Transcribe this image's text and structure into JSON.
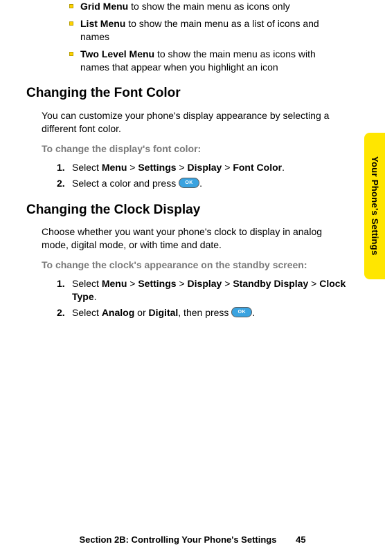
{
  "side_tab": "Your Phone's Settings",
  "bullets": [
    {
      "bold": "Grid Menu",
      "rest": " to show the main menu as icons only"
    },
    {
      "bold": "List Menu",
      "rest": " to show the main menu as a list of icons and names"
    },
    {
      "bold": "Two Level Menu",
      "rest": " to show the main menu as icons with names that appear when you highlight an icon"
    }
  ],
  "section1": {
    "heading": "Changing the Font Color",
    "para": "You can customize your phone's display appearance by selecting a different font color.",
    "instruction": "To change the display's font color:",
    "steps": {
      "s1_pre": "Select ",
      "s1_b1": "Menu",
      "s1_gt1": " > ",
      "s1_b2": "Settings",
      "s1_gt2": " > ",
      "s1_b3": "Display",
      "s1_gt3": " > ",
      "s1_b4": "Font Color",
      "s1_end": ".",
      "s2_pre": "Select a color and press ",
      "s2_end": "."
    }
  },
  "section2": {
    "heading": "Changing the Clock Display",
    "para": "Choose whether you want your phone's clock to display in analog mode, digital mode, or with time and date.",
    "instruction": "To change the clock's appearance on the standby screen:",
    "steps": {
      "s1_pre": "Select ",
      "s1_b1": "Menu",
      "s1_gt1": " > ",
      "s1_b2": "Settings",
      "s1_gt2": " > ",
      "s1_b3": "Display",
      "s1_gt3": " > ",
      "s1_b4": "Standby Display",
      "s1_gt4": " > ",
      "s1_b5": "Clock Type",
      "s1_end": ".",
      "s2_pre": "Select ",
      "s2_b1": "Analog",
      "s2_mid": " or ",
      "s2_b2": "Digital",
      "s2_post": ", then press ",
      "s2_end": "."
    }
  },
  "ok_label": "OK",
  "num1": "1.",
  "num2": "2.",
  "footer": {
    "title": "Section 2B: Controlling Your Phone's Settings",
    "page": "45"
  }
}
